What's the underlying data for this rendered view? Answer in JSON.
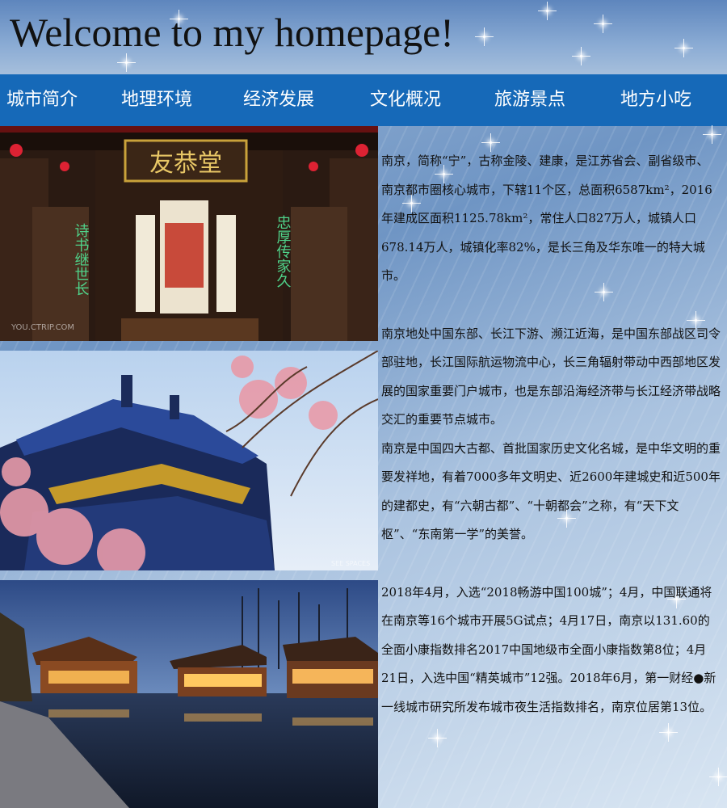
{
  "header": {
    "title": "Welcome to my homepage!"
  },
  "nav": {
    "items": [
      {
        "label": "城市简介"
      },
      {
        "label": "地理环境"
      },
      {
        "label": "经济发展"
      },
      {
        "label": "文化概况"
      },
      {
        "label": "旅游景点"
      },
      {
        "label": "地方小吃"
      }
    ]
  },
  "photos": {
    "hall_plaque": "友恭堂",
    "hall_left_couplet": "诗书继世长",
    "hall_right_couplet": "忠厚传家久",
    "watermark1": "YOU.CTRIP.COM",
    "watermark2": "SEE SPACES"
  },
  "content": {
    "p1": "南京，简称“宁”，古称金陵、建康，是江苏省会、副省级市、南京都市圈核心城市，下辖11个区，总面积6587km²，2016年建成区面积1125.78km²，常住人口827万人，城镇人口678.14万人，城镇化率82%，是长三角及华东唯一的特大城市。",
    "p2": "南京地处中国东部、长江下游、濒江近海，是中国东部战区司令部驻地，长江国际航运物流中心，长三角辐射带动中西部地区发展的国家重要门户城市，也是东部沿海经济带与长江经济带战略交汇的重要节点城市。",
    "p3": "南京是中国四大古都、首批国家历史文化名城，是中华文明的重要发祥地，有着7000多年文明史、近2600年建城史和近500年的建都史，有“六朝古都”、“十朝都会”之称，有“天下文枢”、“东南第一学”的美誉。",
    "p4": "2018年4月，入选“2018畅游中国100城”；4月，中国联通将在南京等16个城市开展5G试点；4月17日，南京以131.60的全面小康指数排名2017中国地级市全面小康指数第8位；4月21日，入选中国“精英城市”12强。2018年6月，第一财经●新一线城市研究所发布城市夜生活指数排名，南京位居第13位。"
  }
}
